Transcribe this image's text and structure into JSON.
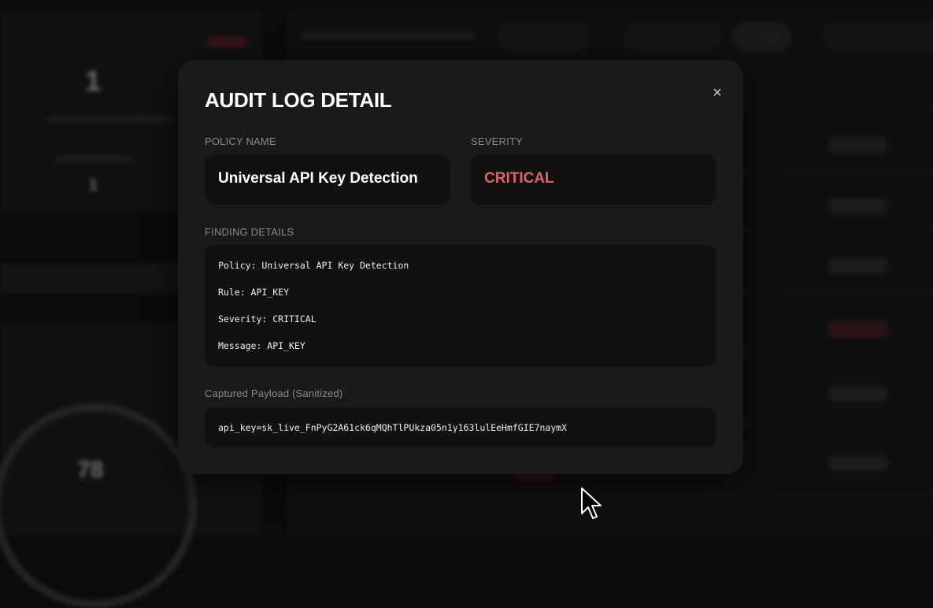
{
  "modal": {
    "title": "AUDIT LOG DETAIL",
    "close_icon": "×",
    "policy_name_label": "POLICY NAME",
    "policy_name": "Universal API Key Detection",
    "severity_label": "SEVERITY",
    "severity": "CRITICAL",
    "severity_color": "#e0636b",
    "finding_details_label": "FINDING DETAILS",
    "finding_details": [
      "Policy: Universal API Key Detection",
      "Rule: API_KEY",
      "Severity: CRITICAL",
      "Message: API_KEY"
    ],
    "payload_label": "Captured Payload (Sanitized)",
    "payload": "api_key=sk_live_FnPyG2A61ck6qMQhTlPUkza05n1y163lulEeHmfGIE7naymX"
  },
  "background": {
    "blurred_values": [
      "1",
      "1",
      "78"
    ]
  },
  "icons": {
    "close": "close-icon",
    "cursor": "mouse-cursor-icon"
  }
}
